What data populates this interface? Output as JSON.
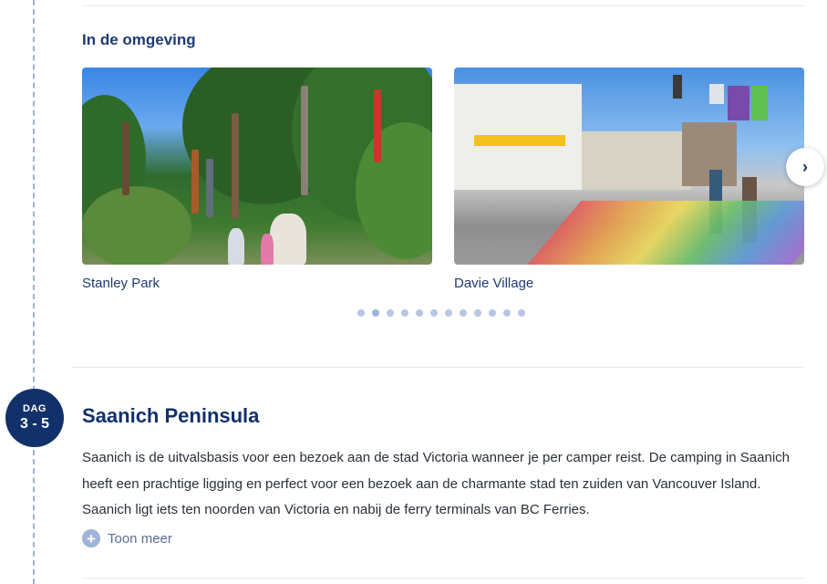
{
  "nearby": {
    "title": "In de omgeving",
    "items": [
      {
        "label": "Stanley Park"
      },
      {
        "label": "Davie Village"
      }
    ],
    "next_icon": "chevron-right-icon",
    "dots": {
      "count": 12,
      "active_index": 1
    }
  },
  "day": {
    "badge_label": "DAG",
    "badge_range": "3 - 5",
    "title": "Saanich Peninsula",
    "description": "Saanich is de uitvalsbasis voor een bezoek aan de stad Victoria wanneer je per camper reist. De camping in Saanich heeft een prachtige ligging en perfect voor een bezoek aan de charmante stad ten zuiden van Vancouver Island. Saanich ligt iets ten noorden van Victoria en nabij de ferry terminals van BC Ferries.",
    "show_more_label": "Toon meer",
    "show_more_icon": "plus-circle-icon"
  },
  "colors": {
    "primary": "#12306a",
    "accent": "#9fb3d8",
    "text": "#2a2f3a"
  }
}
